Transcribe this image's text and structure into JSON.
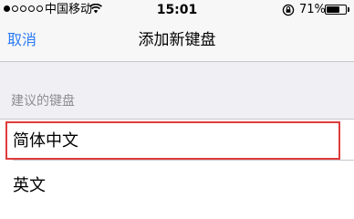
{
  "status_bar": {
    "carrier": "中国移动",
    "time": "15:01",
    "battery_percent": "71%",
    "battery_level": 0.71,
    "signal_bars_filled": 1,
    "signal_bars_total": 5,
    "icons": [
      "wifi-icon",
      "rotation-lock-icon",
      "battery-icon"
    ]
  },
  "nav": {
    "cancel_label": "取消",
    "title": "添加新键盘"
  },
  "section": {
    "header": "建议的键盘"
  },
  "keyboards": [
    {
      "label": "简体中文",
      "highlighted": true
    },
    {
      "label": "英文",
      "highlighted": false
    }
  ],
  "colors": {
    "accent": "#2b7bf4",
    "highlight_border": "#e03c3c",
    "background": "#efeff4",
    "section_header": "#8e8e93"
  }
}
